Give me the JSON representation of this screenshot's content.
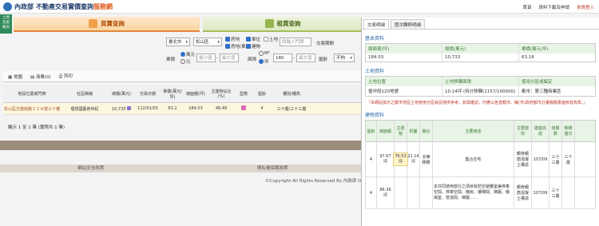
{
  "header": {
    "logo_org": "內政部",
    "logo_title": "不動產交易實價查詢",
    "logo_highlight": "服務網",
    "links": [
      "首頁",
      "資料下載及申請",
      "會員登入"
    ]
  },
  "sidetab": {
    "label": "土地\n房屋\n概況"
  },
  "tabs": {
    "buy": "買賣查詢",
    "rent": "租賃查詢"
  },
  "filters": {
    "city": "臺北市",
    "district": "松山區",
    "type_house": "房地",
    "type_park": "車位",
    "type_land": "土地",
    "type_house_park": "房地(車)",
    "type_building": "建物",
    "keyword_placeholder": "請輸入門牌",
    "period_label": "交易期間",
    "price_label": "單價",
    "price_unit_wan": "萬元",
    "price_unit_yuan": "元",
    "price_min": "最小值",
    "price_max": "最大值",
    "area_label": "面積",
    "area_m2": "M²",
    "area_ping": "坪",
    "area_min": "180",
    "area_max": "最大值",
    "age_label": "屋齡",
    "age_value": "不拘"
  },
  "results": {
    "map_label": "地圖",
    "list_label": "清單(0)",
    "print_label": "列印"
  },
  "table": {
    "headers": [
      "地段位置或門牌",
      "社區簡稱",
      "總價(萬元)",
      "交易日期",
      "單價(萬元/坪)",
      "總面積(坪)",
      "主建物佔比(%)",
      "型態",
      "屋齡",
      "樓別/樓高"
    ],
    "row": [
      "松山區光復南路３２８號三十樓",
      "理想國藝術世紀",
      "10,733",
      "112/01/03",
      "63.2",
      "184.03",
      "48.48",
      "",
      "4",
      "三十層/三十三層"
    ],
    "note": "顯示 1 至 1 筆 (實際共 1 筆)"
  },
  "footer": {
    "links": [
      "網站安全政策",
      "隱私權保護政策"
    ],
    "copyright": "©Copyright All Rights Reserved By 內政部 Dept"
  },
  "panel": {
    "tabs": [
      "交易明細",
      "歷次轉移明細"
    ],
    "basic_title": "基本資料",
    "basic_headers": [
      "總面積(坪)",
      "總價(萬元)",
      "單價(萬元/坪)"
    ],
    "basic_values": [
      "184.03",
      "10,733",
      "63.18"
    ],
    "land_title": "土地資料",
    "land_headers": [
      "土地位置",
      "土地移轉面積",
      "使用分區或編定"
    ],
    "land_values": [
      "復中段120地號",
      "10.14坪 (持分移轉(1157/100000)",
      "都市：第三種商業區"
    ],
    "warning": "「本網站揭示之都市地區土地使用分區資訊僅供參考，如需確認，仍應以各直轄市、縣(市)政府都市計畫機關書面核發為準。」",
    "building_title": "建物資料",
    "building_headers": [
      "屋齡",
      "總面積",
      "主建物",
      "附屬",
      "陽台",
      "主要用途",
      "主要建材",
      "建築完成",
      "總層數",
      "移轉層次"
    ],
    "building_rows": [
      [
        "4",
        "97.67坪",
        "76.53坪",
        "21.14坪",
        "全棟移轉",
        "集合住宅",
        "鋼骨鋼筋混凝土構造",
        "107/09",
        "三十三層",
        "三十層"
      ],
      [
        "4",
        "86.36坪",
        "",
        "",
        "",
        "本共同使用部分之項目有防空避難室兼停車空間、停車空間、機房、樓梯間、梯廳、機械室、管道間、梯廳……",
        "鋼骨鋼筋混凝土構造",
        "107/09",
        "三十三層",
        ""
      ]
    ]
  }
}
